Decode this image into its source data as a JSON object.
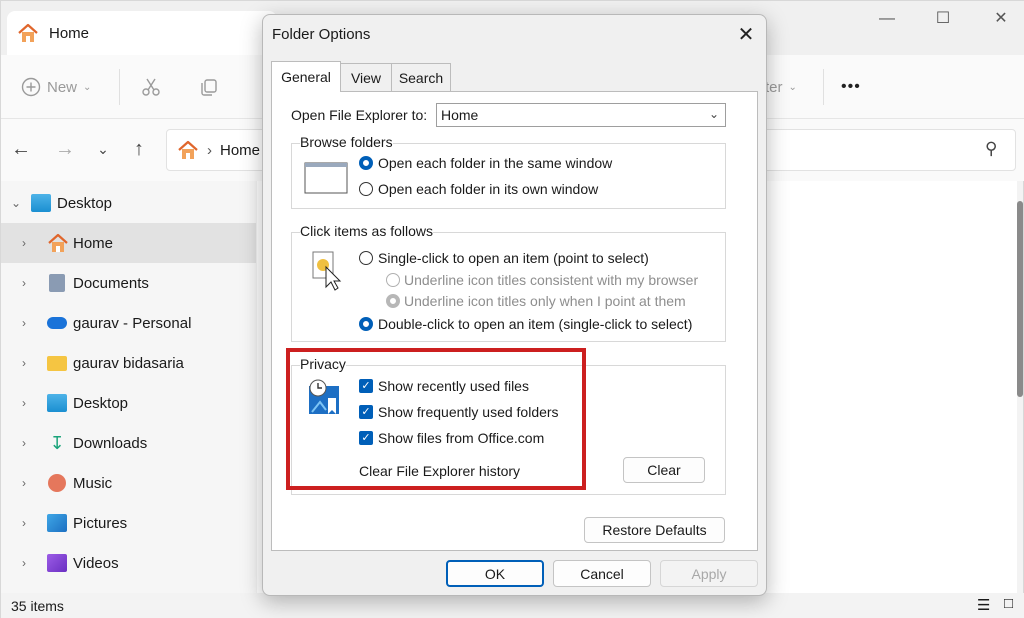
{
  "explorer": {
    "tab_title": "Home",
    "toolbar": {
      "new_label": "New",
      "filter_label_partial": "ter",
      "more_label": "•••"
    },
    "address": {
      "crumb": "Home"
    },
    "nav": {
      "items": [
        {
          "label": "Desktop",
          "expanded": true
        },
        {
          "label": "Home",
          "selected": true
        },
        {
          "label": "Documents"
        },
        {
          "label": "gaurav - Personal"
        },
        {
          "label": "gaurav bidasaria"
        },
        {
          "label": "Desktop"
        },
        {
          "label": "Downloads"
        },
        {
          "label": "Music"
        },
        {
          "label": "Pictures"
        },
        {
          "label": "Videos"
        }
      ]
    },
    "status": {
      "item_count": "35 items"
    }
  },
  "dialog": {
    "title": "Folder Options",
    "tabs": [
      {
        "label": "General",
        "active": true
      },
      {
        "label": "View"
      },
      {
        "label": "Search"
      }
    ],
    "open_to": {
      "label": "Open File Explorer to:",
      "value": "Home"
    },
    "browse_folders": {
      "label": "Browse folders",
      "options": [
        {
          "label": "Open each folder in the same window",
          "checked": true
        },
        {
          "label": "Open each folder in its own window",
          "checked": false
        }
      ]
    },
    "click_items": {
      "label": "Click items as follows",
      "single_click": "Single-click to open an item (point to select)",
      "underline_browser": "Underline icon titles consistent with my browser",
      "underline_point": "Underline icon titles only when I point at them",
      "double_click": "Double-click to open an item (single-click to select)"
    },
    "privacy": {
      "label": "Privacy",
      "recent_files": "Show recently used files",
      "frequent_folders": "Show frequently used folders",
      "office_files": "Show files from Office.com",
      "clear_history_label": "Clear File Explorer history",
      "clear_button": "Clear"
    },
    "restore_defaults": "Restore Defaults",
    "ok": "OK",
    "cancel": "Cancel",
    "apply": "Apply"
  },
  "colors": {
    "accent": "#005fb8",
    "highlight_box": "#cc1f1f"
  }
}
